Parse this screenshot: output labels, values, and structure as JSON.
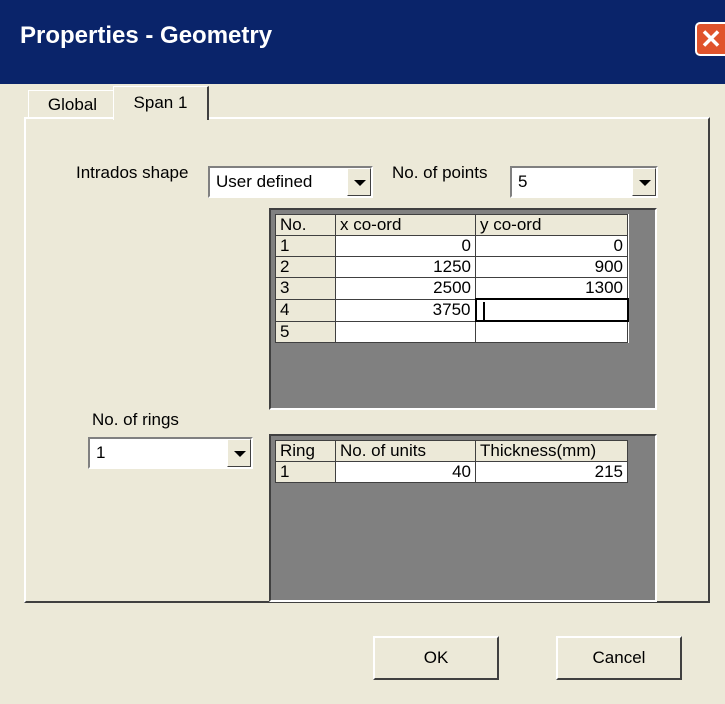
{
  "window": {
    "title": "Properties - Geometry",
    "close_icon": "close-icon"
  },
  "tabs": [
    {
      "label": "Global"
    },
    {
      "label": "Span 1"
    }
  ],
  "intrados": {
    "label": "Intrados shape",
    "value": "User defined"
  },
  "points": {
    "label": "No. of points",
    "value": "5"
  },
  "coord_table": {
    "headers": [
      "No.",
      "x co-ord",
      "y co-ord"
    ],
    "rows": [
      [
        "1",
        "0",
        "0"
      ],
      [
        "2",
        "1250",
        "900"
      ],
      [
        "3",
        "2500",
        "1300"
      ],
      [
        "4",
        "3750",
        ""
      ],
      [
        "5",
        "",
        ""
      ]
    ]
  },
  "rings": {
    "label": "No. of rings",
    "value": "1"
  },
  "ring_table": {
    "headers": [
      "Ring",
      "No. of units",
      "Thickness(mm)"
    ],
    "rows": [
      [
        "1",
        "40",
        "215"
      ]
    ]
  },
  "buttons": {
    "ok": "OK",
    "cancel": "Cancel"
  }
}
